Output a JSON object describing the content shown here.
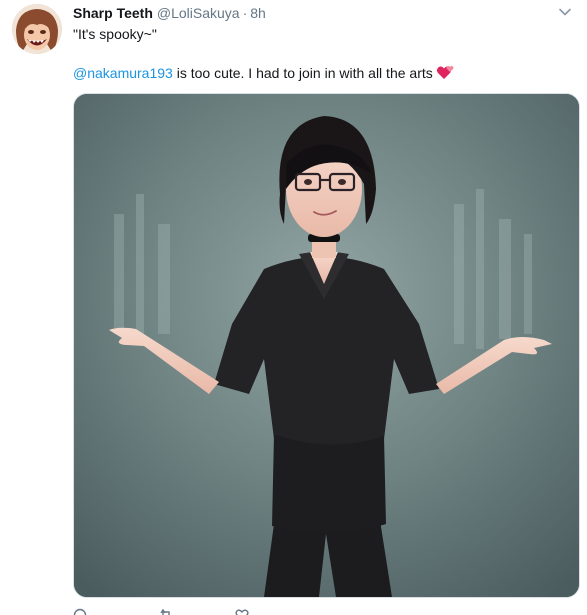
{
  "tweet": {
    "author": {
      "display_name": "Sharp Teeth",
      "handle": "@LoliSakuya",
      "separator": "·",
      "time_ago": "8h"
    },
    "quote_text": "\"It's spooky~\"",
    "mention": "@nakamura193",
    "body_text": " is too cute. I had to join in with all the arts",
    "emoji": "two-hearts-emoji"
  },
  "colors": {
    "link": "#1b95e0",
    "secondary_text": "#657786",
    "primary_text": "#14171a",
    "heart": "#e0245e"
  },
  "icons": {
    "more": "chevron-down-icon",
    "reply": "reply-icon",
    "retweet": "retweet-icon",
    "like": "like-icon"
  }
}
